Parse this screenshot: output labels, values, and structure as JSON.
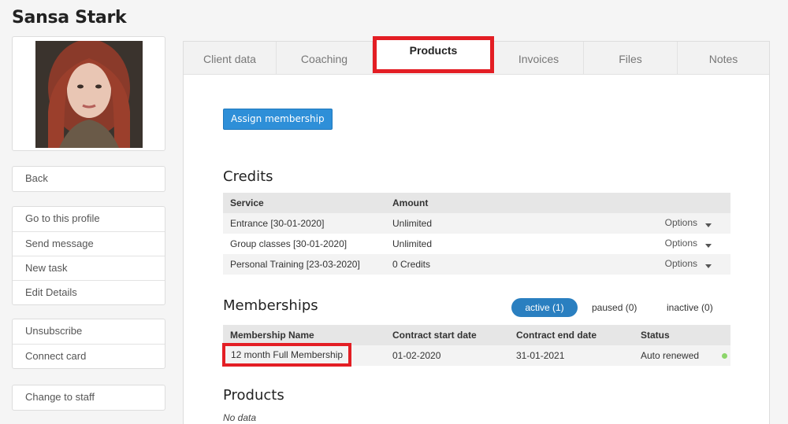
{
  "client": {
    "name": "Sansa Stark"
  },
  "sidebar": {
    "back": "Back",
    "group1": [
      "Go to this profile",
      "Send message",
      "New task",
      "Edit Details"
    ],
    "group2": [
      "Unsubscribe",
      "Connect card"
    ],
    "group3": [
      "Change to staff"
    ]
  },
  "tabs": [
    "Client data",
    "Coaching",
    "Products",
    "Invoices",
    "Files",
    "Notes"
  ],
  "active_tab": "Products",
  "assign_button": "Assign membership",
  "credits": {
    "title": "Credits",
    "headers": {
      "service": "Service",
      "amount": "Amount"
    },
    "options_label": "Options",
    "rows": [
      {
        "service": "Entrance [30-01-2020]",
        "amount": "Unlimited"
      },
      {
        "service": "Group classes [30-01-2020]",
        "amount": "Unlimited"
      },
      {
        "service": "Personal Training [23-03-2020]",
        "amount": "0 Credits"
      }
    ]
  },
  "memberships": {
    "title": "Memberships",
    "filters": {
      "active": "active (1)",
      "paused": "paused (0)",
      "inactive": "inactive (0)"
    },
    "headers": {
      "name": "Membership Name",
      "start": "Contract start date",
      "end": "Contract end date",
      "status": "Status"
    },
    "rows": [
      {
        "name": "12 month Full Membership",
        "start": "01-02-2020",
        "end": "31-01-2021",
        "status": "Auto renewed"
      }
    ]
  },
  "products": {
    "title": "Products",
    "empty": "No data"
  },
  "colors": {
    "primary": "#2e8fd8",
    "highlight": "#e31e24",
    "status_ok": "#8cd56a"
  }
}
